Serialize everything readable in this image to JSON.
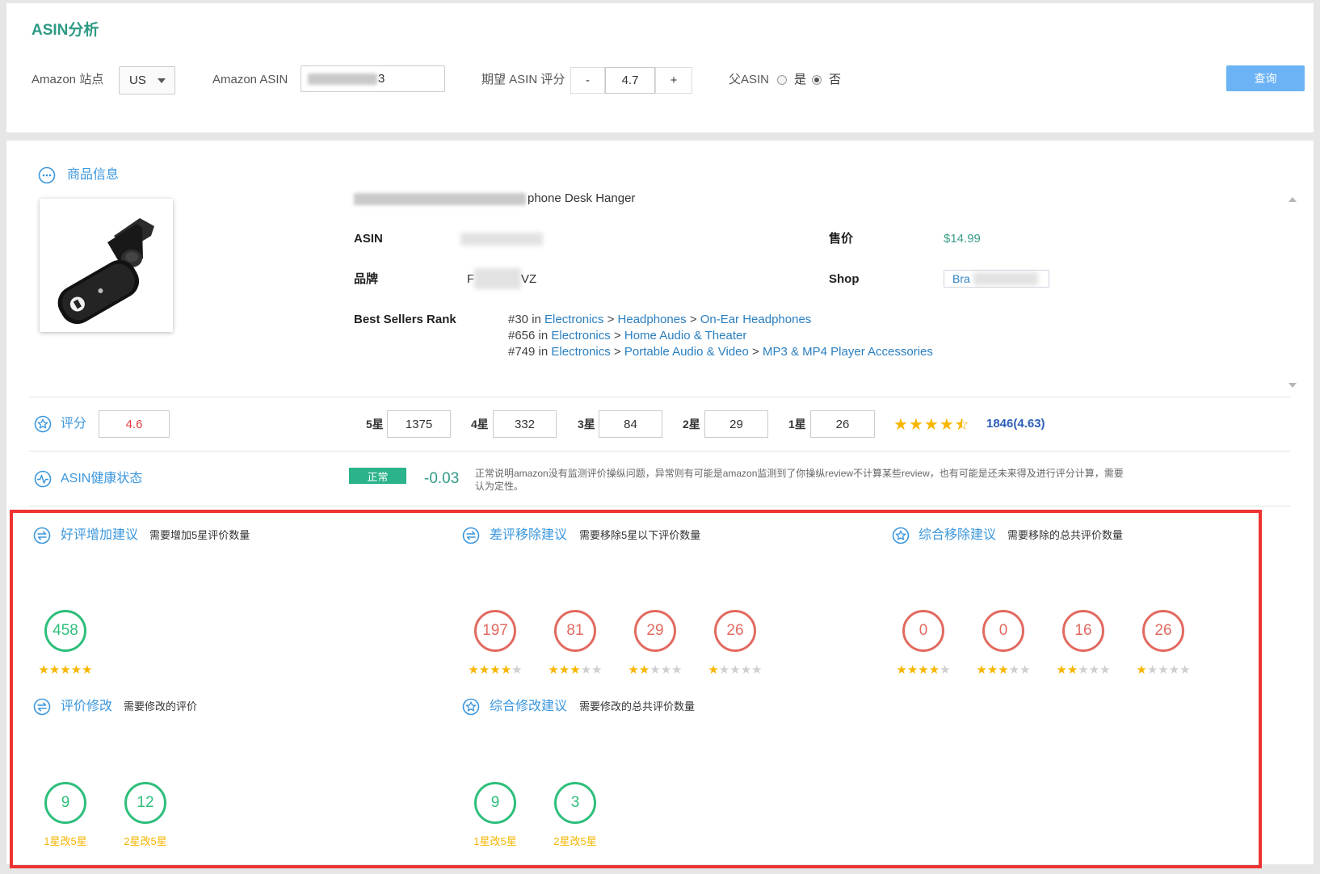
{
  "page": {
    "title": "ASIN分析"
  },
  "search": {
    "site": {
      "label": "Amazon 站点",
      "value": "US"
    },
    "asin": {
      "label": "Amazon ASIN",
      "value": "3"
    },
    "target_rating": {
      "label": "期望 ASIN 评分",
      "minus": "-",
      "value": "4.7",
      "plus": "+"
    },
    "parent_asin": {
      "label": "父ASIN",
      "options": [
        "是",
        "否"
      ],
      "selected": 1
    },
    "query_button": "查询"
  },
  "product": {
    "section_title": "商品信息",
    "title_visible": "phone Desk Hanger",
    "asin_label": "ASIN",
    "price_label": "售价",
    "price": "$14.99",
    "brand_label": "品牌",
    "brand_prefix": "F",
    "brand_suffix": "VZ",
    "shop_label": "Shop",
    "shop_value": "Bra",
    "bsr_label": "Best Sellers Rank",
    "separator": ">",
    "ranks": [
      {
        "position": "#30 in",
        "path": [
          "Electronics",
          "Headphones",
          "On-Ear Headphones"
        ]
      },
      {
        "position": "#656 in",
        "path": [
          "Electronics",
          "Home Audio & Theater"
        ]
      },
      {
        "position": "#749 in",
        "path": [
          "Electronics",
          "Portable Audio & Video",
          "MP3 & MP4 Player Accessories"
        ]
      }
    ]
  },
  "rating": {
    "label": "评分",
    "value": "4.6",
    "breakdown": [
      {
        "label": "5星",
        "count": "1375"
      },
      {
        "label": "4星",
        "count": "332"
      },
      {
        "label": "3星",
        "count": "84"
      },
      {
        "label": "2星",
        "count": "29"
      },
      {
        "label": "1星",
        "count": "26"
      }
    ],
    "stars": 4.5,
    "summary": "1846(4.63)"
  },
  "health": {
    "label": "ASIN健康状态",
    "status": "正常",
    "delta": "-0.03",
    "description": "正常说明amazon没有监测评价操纵问题，异常则有可能是amazon监测到了你操纵review不计算某些review，也有可能是还未来得及进行评分计算，需要认为定性。"
  },
  "suggestions": {
    "positive_add": {
      "title": "好评增加建议",
      "subtitle": "需要增加5星评价数量",
      "items": [
        {
          "value": "458",
          "stars": 5
        }
      ]
    },
    "negative_remove": {
      "title": "差评移除建议",
      "subtitle": "需要移除5星以下评价数量",
      "items": [
        {
          "value": "197",
          "stars": 4
        },
        {
          "value": "81",
          "stars": 3
        },
        {
          "value": "29",
          "stars": 2
        },
        {
          "value": "26",
          "stars": 1
        }
      ]
    },
    "total_remove": {
      "title": "综合移除建议",
      "subtitle": "需要移除的总共评价数量",
      "items": [
        {
          "value": "0",
          "stars": 4
        },
        {
          "value": "0",
          "stars": 3
        },
        {
          "value": "16",
          "stars": 2
        },
        {
          "value": "26",
          "stars": 1
        }
      ]
    },
    "review_modify": {
      "title": "评价修改",
      "subtitle": "需要修改的评价",
      "items": [
        {
          "value": "9",
          "label": "1星改5星"
        },
        {
          "value": "12",
          "label": "2星改5星"
        }
      ]
    },
    "total_modify": {
      "title": "综合修改建议",
      "subtitle": "需要修改的总共评价数量",
      "items": [
        {
          "value": "9",
          "label": "1星改5星"
        },
        {
          "value": "3",
          "label": "2星改5星"
        }
      ]
    }
  },
  "colors": {
    "title_teal": "#2e9a85",
    "section_blue": "#3b97dd",
    "link_blue": "#2a7fc0",
    "query_button": "#6cb3f5",
    "good_green": "#2dbf7b",
    "bad_red": "#e26a60",
    "star_gold": "#f8b600",
    "highlight_red": "#ee3333"
  }
}
